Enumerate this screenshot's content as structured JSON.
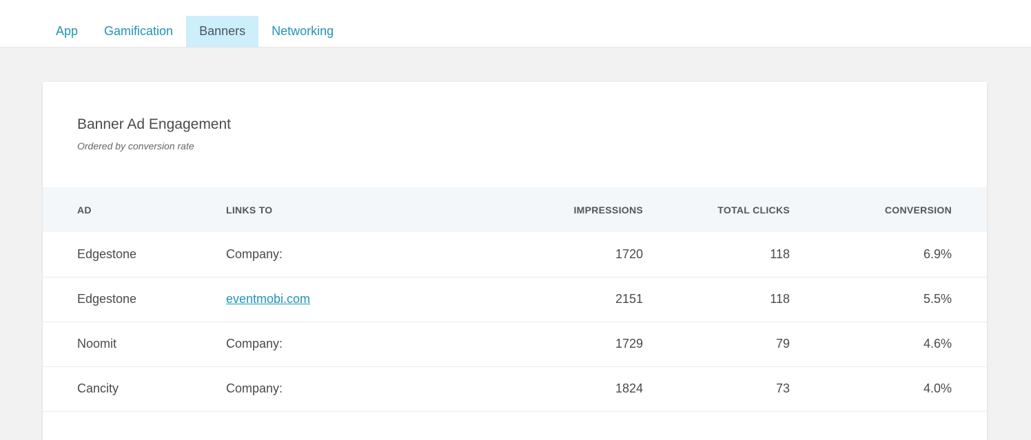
{
  "tabs": [
    {
      "label": "App"
    },
    {
      "label": "Gamification"
    },
    {
      "label": "Banners"
    },
    {
      "label": "Networking"
    }
  ],
  "active_tab": "Banners",
  "card": {
    "title": "Banner Ad Engagement",
    "subtitle": "Ordered by conversion rate"
  },
  "table": {
    "headers": {
      "ad": "AD",
      "links_to": "LINKS TO",
      "impressions": "IMPRESSIONS",
      "total_clicks": "TOTAL CLICKS",
      "conversion": "CONVERSION"
    },
    "rows": [
      {
        "ad": "Edgestone",
        "links_to": "Company:",
        "is_link": false,
        "impressions": "1720",
        "total_clicks": "118",
        "conversion": "6.9%"
      },
      {
        "ad": "Edgestone",
        "links_to": "eventmobi.com",
        "is_link": true,
        "impressions": "2151",
        "total_clicks": "118",
        "conversion": "5.5%"
      },
      {
        "ad": "Noomit",
        "links_to": "Company:",
        "is_link": false,
        "impressions": "1729",
        "total_clicks": "79",
        "conversion": "4.6%"
      },
      {
        "ad": "Cancity",
        "links_to": "Company:",
        "is_link": false,
        "impressions": "1824",
        "total_clicks": "73",
        "conversion": "4.0%"
      }
    ]
  },
  "colors": {
    "accent": "#1f94b8",
    "active_tab_bg": "#cdeefb",
    "page_bg": "#f2f2f2",
    "table_header_bg": "#f3f7f9"
  }
}
